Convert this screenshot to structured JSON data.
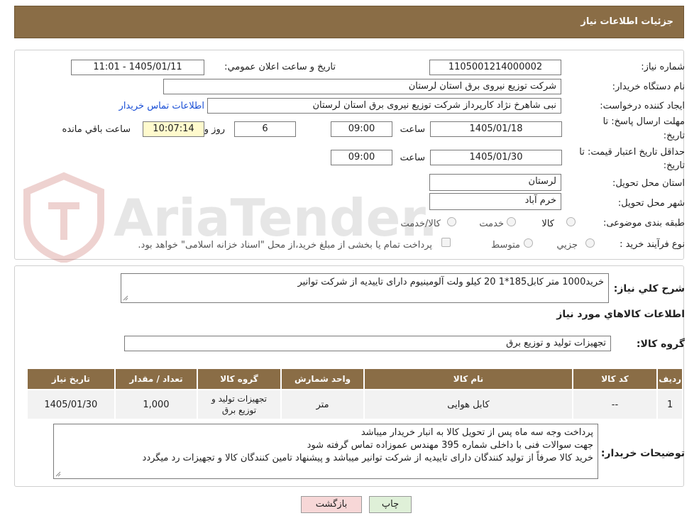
{
  "header": {
    "title": "جزئیات اطلاعات نیاز"
  },
  "info": {
    "need_number_label": "شماره نیاز:",
    "need_number": "1105001214000002",
    "announce_label": "تاریخ و ساعت اعلان عمومي:",
    "announce_value": "1405/01/11 - 11:01",
    "buyer_org_label": "نام دستگاه خریدار:",
    "buyer_org": "شرکت توزیع نیروی برق استان لرستان",
    "creator_label": "ایجاد کننده درخواست:",
    "creator": "نبی شاهرخ نژاد کارپرداز شرکت توزیع نیروی برق استان لرستان",
    "contact_link": "اطلاعات تماس خریدار",
    "deadline_label_1": "مهلت ارسال پاسخ: تا",
    "deadline_label_2": "تاریخ:",
    "deadline_date": "1405/01/18",
    "time_label": "ساعت",
    "deadline_time": "09:00",
    "days_value": "6",
    "days_label": "روز و",
    "remaining_time": "10:07:14",
    "remaining_label": "ساعت باقي مانده",
    "validity_label_1": "حداقل تاریخ اعتبار قیمت: تا",
    "validity_label_2": "تاریخ:",
    "validity_date": "1405/01/30",
    "validity_time": "09:00",
    "province_label": "استان محل تحویل:",
    "province": "لرستان",
    "city_label": "شهر محل تحویل:",
    "city": "خرم آباد",
    "category_label": "طبقه بندی موضوعی:",
    "category_options": [
      "کالا",
      "خدمت",
      "کالا/خدمت"
    ],
    "process_label": "نوع فرآیند خرید :",
    "process_options": [
      "جزیي",
      "متوسط"
    ],
    "payment_note": "پرداخت تمام یا بخشی از مبلغ خرید،از محل \"اسناد خزانه اسلامی\" خواهد بود."
  },
  "watermark": {
    "text": "AriaTender.neT"
  },
  "description": {
    "label": "شرح كلي نياز:",
    "text": "خرید1000 متر کابل185*1  20 کیلو ولت آلومینیوم دارای تاییدیه از شرکت توانیر"
  },
  "goods": {
    "section_title": "اطلاعات كالاهاي مورد نياز",
    "group_label": "گروه کالا:",
    "group_value": "تجهیزات تولید و توزیع برق",
    "columns": [
      "ردیف",
      "کد کالا",
      "نام کالا",
      "واحد شمارش",
      "گروه کالا",
      "تعداد / مقدار",
      "تاریخ نیاز"
    ],
    "rows": [
      {
        "row": "1",
        "code": "--",
        "name": "کابل هوایی",
        "unit": "متر",
        "group": "تجهیزات تولید و توزیع برق",
        "qty": "1,000",
        "date": "1405/01/30"
      }
    ]
  },
  "buyer_notes": {
    "label": "توضیحات خریدار:",
    "lines": [
      "پرداخت وجه سه ماه پس از تحویل کالا  به انبار خریدار میباشد",
      "جهت سوالات فنی با داخلی شماره 395 مهندس عموزاده تماس گرفته شود",
      "خرید کالا صرفاً از تولید کنندگان دارای تاییدیه از شرکت توانیر میباشد و پیشنهاد تامین کنندگان کالا و تجهیزات رد میگردد"
    ]
  },
  "buttons": {
    "print": "چاپ",
    "back": "بازگشت"
  }
}
